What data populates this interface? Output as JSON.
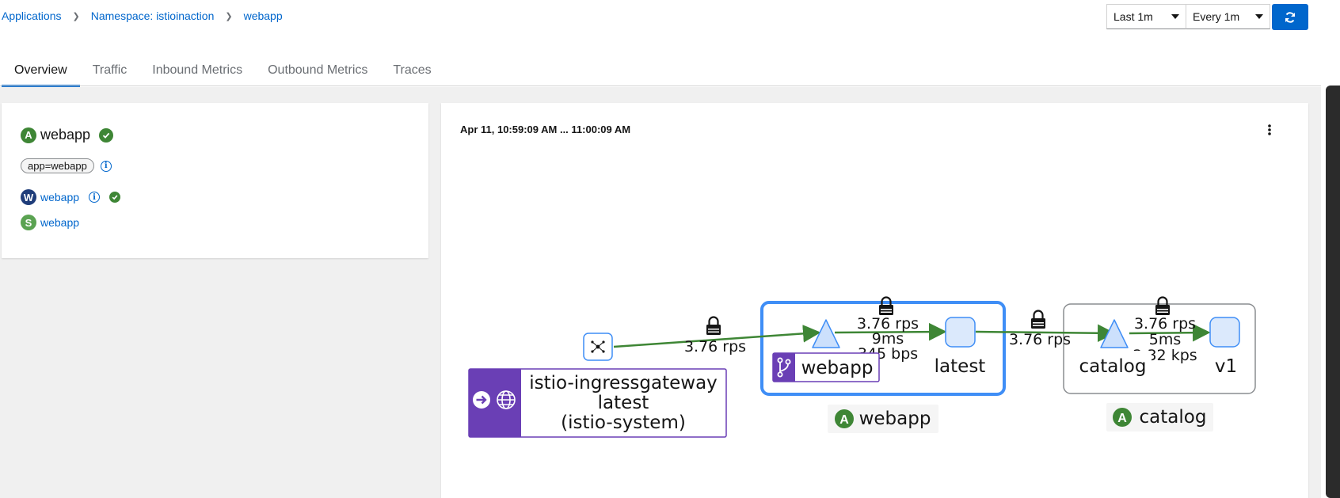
{
  "breadcrumb": {
    "items": [
      "Applications",
      "Namespace: istioinaction",
      "webapp"
    ]
  },
  "controls": {
    "duration": "Last 1m",
    "refresh_interval": "Every 1m"
  },
  "tabs": [
    "Overview",
    "Traffic",
    "Inbound Metrics",
    "Outbound Metrics",
    "Traces"
  ],
  "active_tab": "Overview",
  "app_card": {
    "badge": "A",
    "title": "webapp",
    "label": "app=webapp",
    "workload": {
      "badge": "W",
      "name": "webapp"
    },
    "service": {
      "badge": "S",
      "name": "webapp"
    }
  },
  "graph": {
    "time_range": "Apr 11, 10:59:09 AM ... 11:00:09 AM",
    "ingress": {
      "name": "istio-ingressgateway",
      "version": "latest",
      "namespace": "(istio-system)"
    },
    "edges": {
      "ingress_to_webapp": "3.76 rps",
      "webapp_internal_rps": "3.76 rps",
      "webapp_internal_latency": "9ms",
      "webapp_internal_bw": "345 bps",
      "webapp_to_catalog": "3.76 rps",
      "catalog_internal_rps": "3.76 rps",
      "catalog_internal_latency": "5ms",
      "catalog_internal_bw": "2.32 kps"
    },
    "webapp_box": {
      "service": "webapp",
      "version": "latest",
      "app_badge": "A",
      "app": "webapp"
    },
    "catalog_box": {
      "service": "catalog",
      "version": "v1",
      "app_badge": "A",
      "app": "catalog"
    }
  },
  "colors": {
    "link": "#0066cc",
    "edge_green": "#3e8635",
    "app_green": "#3e8635",
    "workload_navy": "#1f3d7a",
    "service_green": "#5ba352",
    "ingress_purple": "#6a3fb5",
    "selected_border": "#3f8ef6"
  }
}
